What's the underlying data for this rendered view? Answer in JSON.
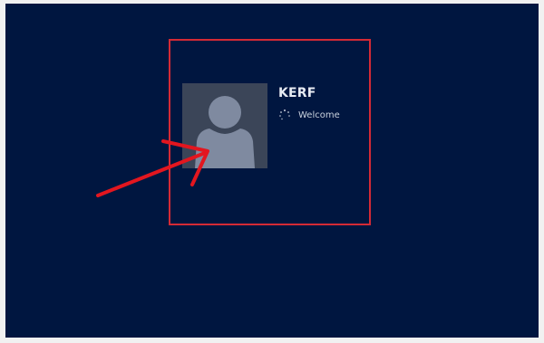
{
  "login": {
    "username": "KERF",
    "status_text": "Welcome",
    "status_icon": "loading-spinner-icon",
    "avatar_icon": "user-silhouette-icon"
  },
  "colors": {
    "background": "#001640",
    "avatar_tile": "#3b4558",
    "avatar_figure": "#7f8aa0",
    "annotation": "#e3161f"
  },
  "annotation": {
    "shape": "rectangle-highlight",
    "pointer": "arrow-icon"
  }
}
